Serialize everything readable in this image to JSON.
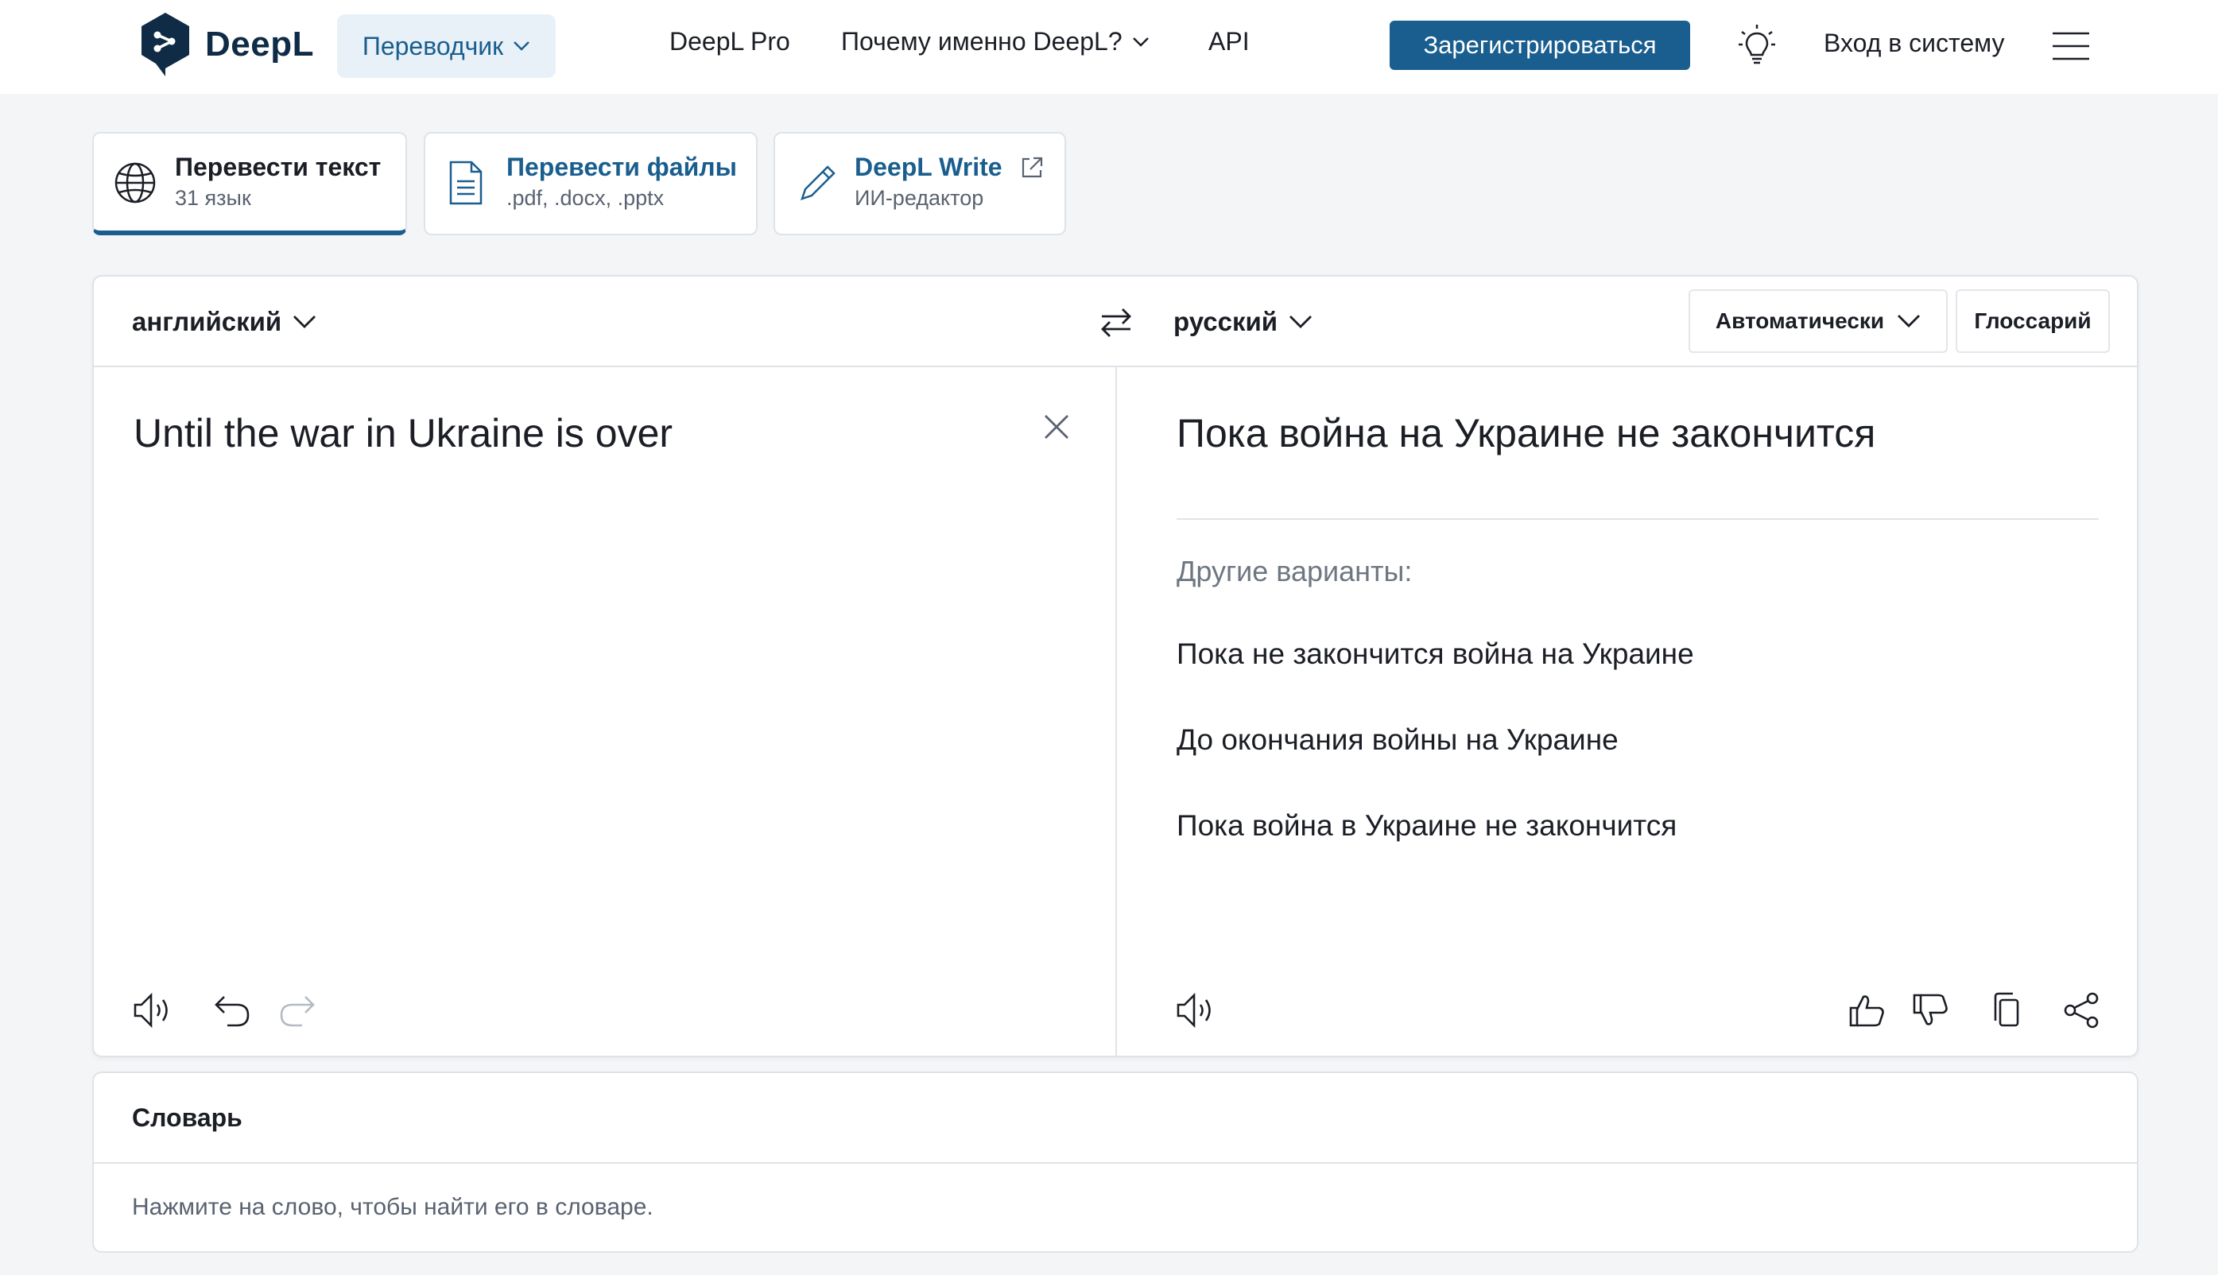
{
  "header": {
    "brand": "DeepL",
    "translator_menu": "Переводчик",
    "nav": {
      "pro": "DeepL Pro",
      "why": "Почему именно DeepL?",
      "api": "API"
    },
    "register_label": "Зарегистрироваться",
    "login_label": "Вход в систему"
  },
  "tabs": [
    {
      "title": "Перевести текст",
      "subtitle": "31 язык",
      "icon": "globe-icon",
      "active": true
    },
    {
      "title": "Перевести файлы",
      "subtitle": ".pdf, .docx, .pptx",
      "icon": "document-icon",
      "active": false
    },
    {
      "title": "DeepL Write",
      "subtitle": "ИИ-редактор",
      "icon": "pencil-icon",
      "active": false
    }
  ],
  "translator": {
    "source_language": "английский",
    "target_language": "русский",
    "formality_label": "Автоматически",
    "glossary_label": "Глоссарий",
    "source_text": "Until the war in Ukraine is over",
    "target_text": "Пока война на Украине не закончится",
    "alternatives_heading": "Другие варианты:",
    "alternatives": [
      "Пока не закончится война на Украине",
      "До окончания войны на Украине",
      "Пока война в Украине не закончится"
    ]
  },
  "dictionary": {
    "title": "Словарь",
    "hint": "Нажмите на слово, чтобы найти его в словаре."
  },
  "colors": {
    "brand_blue": "#1a5e8f",
    "logo_navy": "#0f2b46",
    "page_bg": "#f3f5f7",
    "border": "#dfe3e8"
  }
}
